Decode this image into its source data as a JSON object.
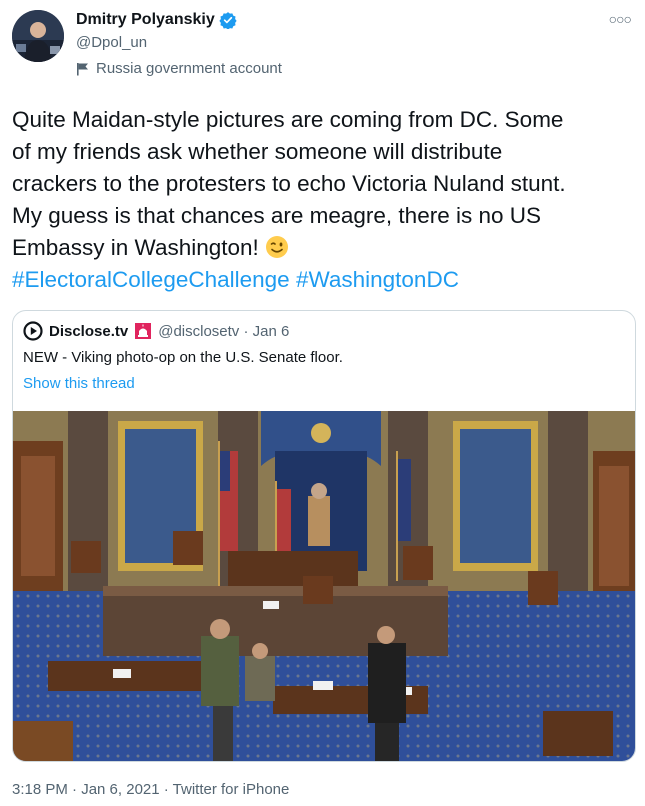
{
  "author": {
    "display_name": "Dmitry Polyanskiy",
    "handle": "@Dpol_un",
    "label": "Russia government account"
  },
  "tweet": {
    "lines": [
      "Quite Maidan-style pictures are coming from DC. Some",
      "of my friends ask whether someone will distribute",
      "crackers to the protesters to echo Victoria Nuland stunt.",
      "My guess is that chances are meagre, there is no US",
      "Embassy in Washington! "
    ],
    "hashtags": [
      "#ElectoralCollegeChallenge",
      "#WashingtonDC"
    ]
  },
  "quote": {
    "name": "Disclose.tv",
    "meta": "@disclosetv · Jan 6",
    "text": "NEW - Viking photo-op on the U.S. Senate floor.",
    "thread_link": "Show this thread"
  },
  "footer": {
    "text": "3:18 PM · Jan 6, 2021 · Twitter for iPhone"
  },
  "colors": {
    "link": "#1d9bf0",
    "muted": "#536471",
    "verified": "#1d9bf0",
    "carpet": "#2f4f9a"
  },
  "icons": [
    "verified-badge-icon",
    "more-icon",
    "flag-icon",
    "wink-emoji-icon",
    "disclose-logo-icon",
    "siren-icon"
  ]
}
